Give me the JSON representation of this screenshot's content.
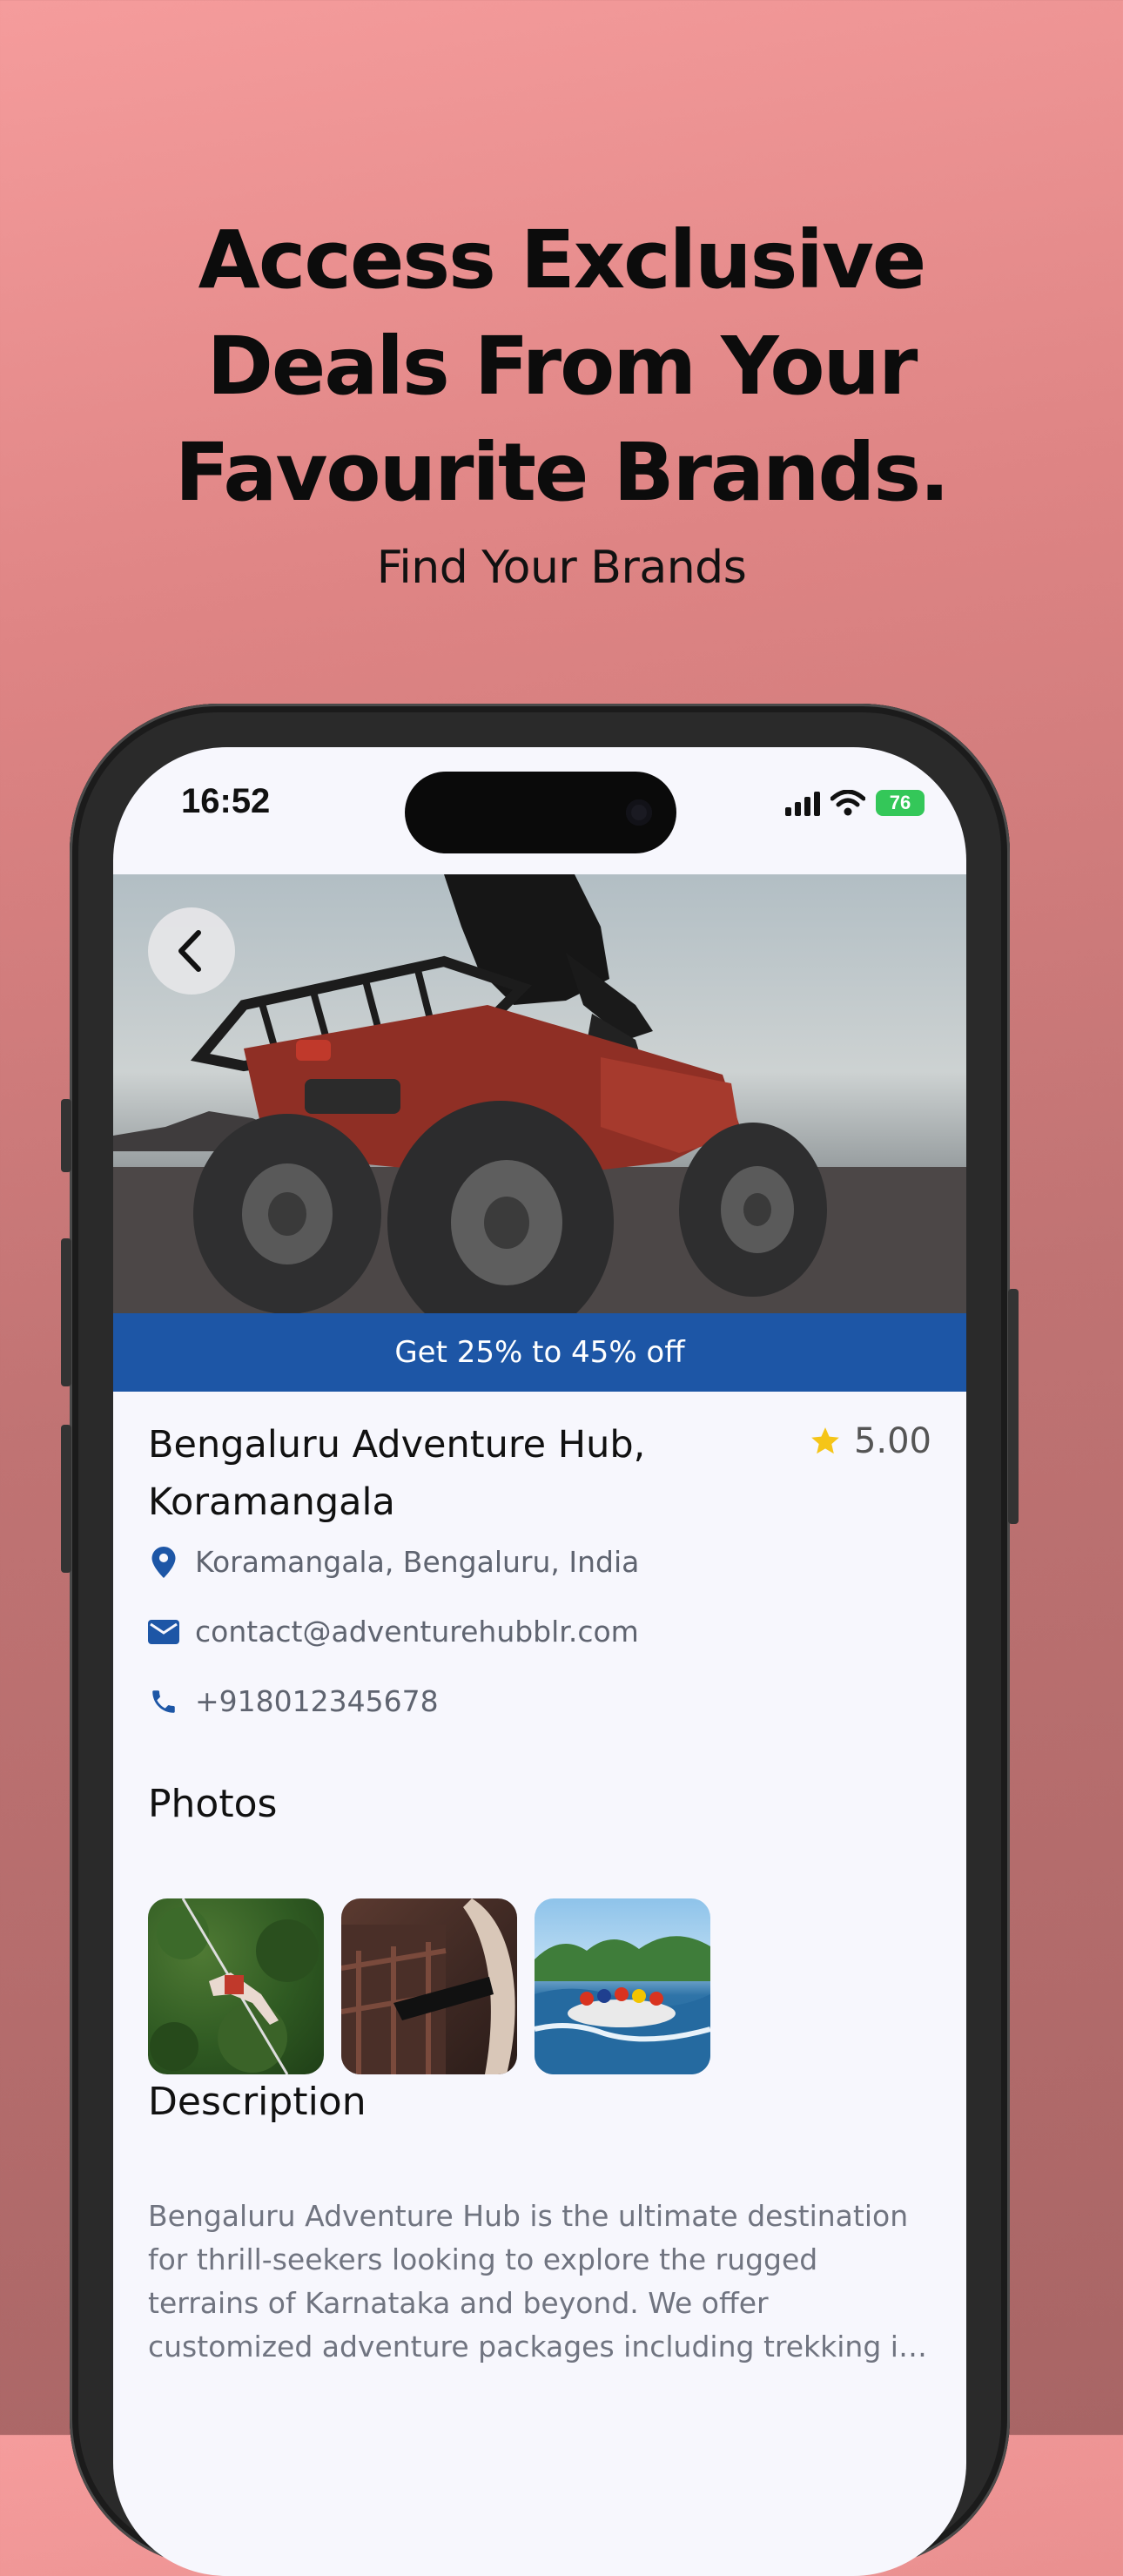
{
  "promo": {
    "headline_lines": [
      "Access Exclusive",
      "Deals From Your",
      "Favourite Brands."
    ],
    "subheadline": "Find Your Brands"
  },
  "status_bar": {
    "time": "16:52",
    "battery": "76"
  },
  "listing": {
    "offer_banner": "Get 25% to 45% off",
    "title_lines": [
      "Bengaluru Adventure Hub,",
      "Koramangala"
    ],
    "rating": "5.00",
    "location": "Koramangala, Bengaluru, India",
    "email": "contact@adventurehubblr.com",
    "phone": "+918012345678",
    "photos_heading": "Photos",
    "description_heading": "Description",
    "description": "Bengaluru Adventure Hub is the ultimate destination for thrill-seekers looking to explore the rugged terrains of Karnataka and beyond. We offer customized adventure packages including trekking in the Western Ghats, river rafting, zip-lining and quad biking."
  },
  "icons": {
    "back": "chevron-left-icon",
    "rating": "star-icon",
    "location": "map-pin-icon",
    "email": "mail-icon",
    "phone": "phone-icon"
  },
  "colors": {
    "accent_blue": "#1d56a6",
    "star_yellow": "#f5c518",
    "battery_green": "#34c759"
  }
}
